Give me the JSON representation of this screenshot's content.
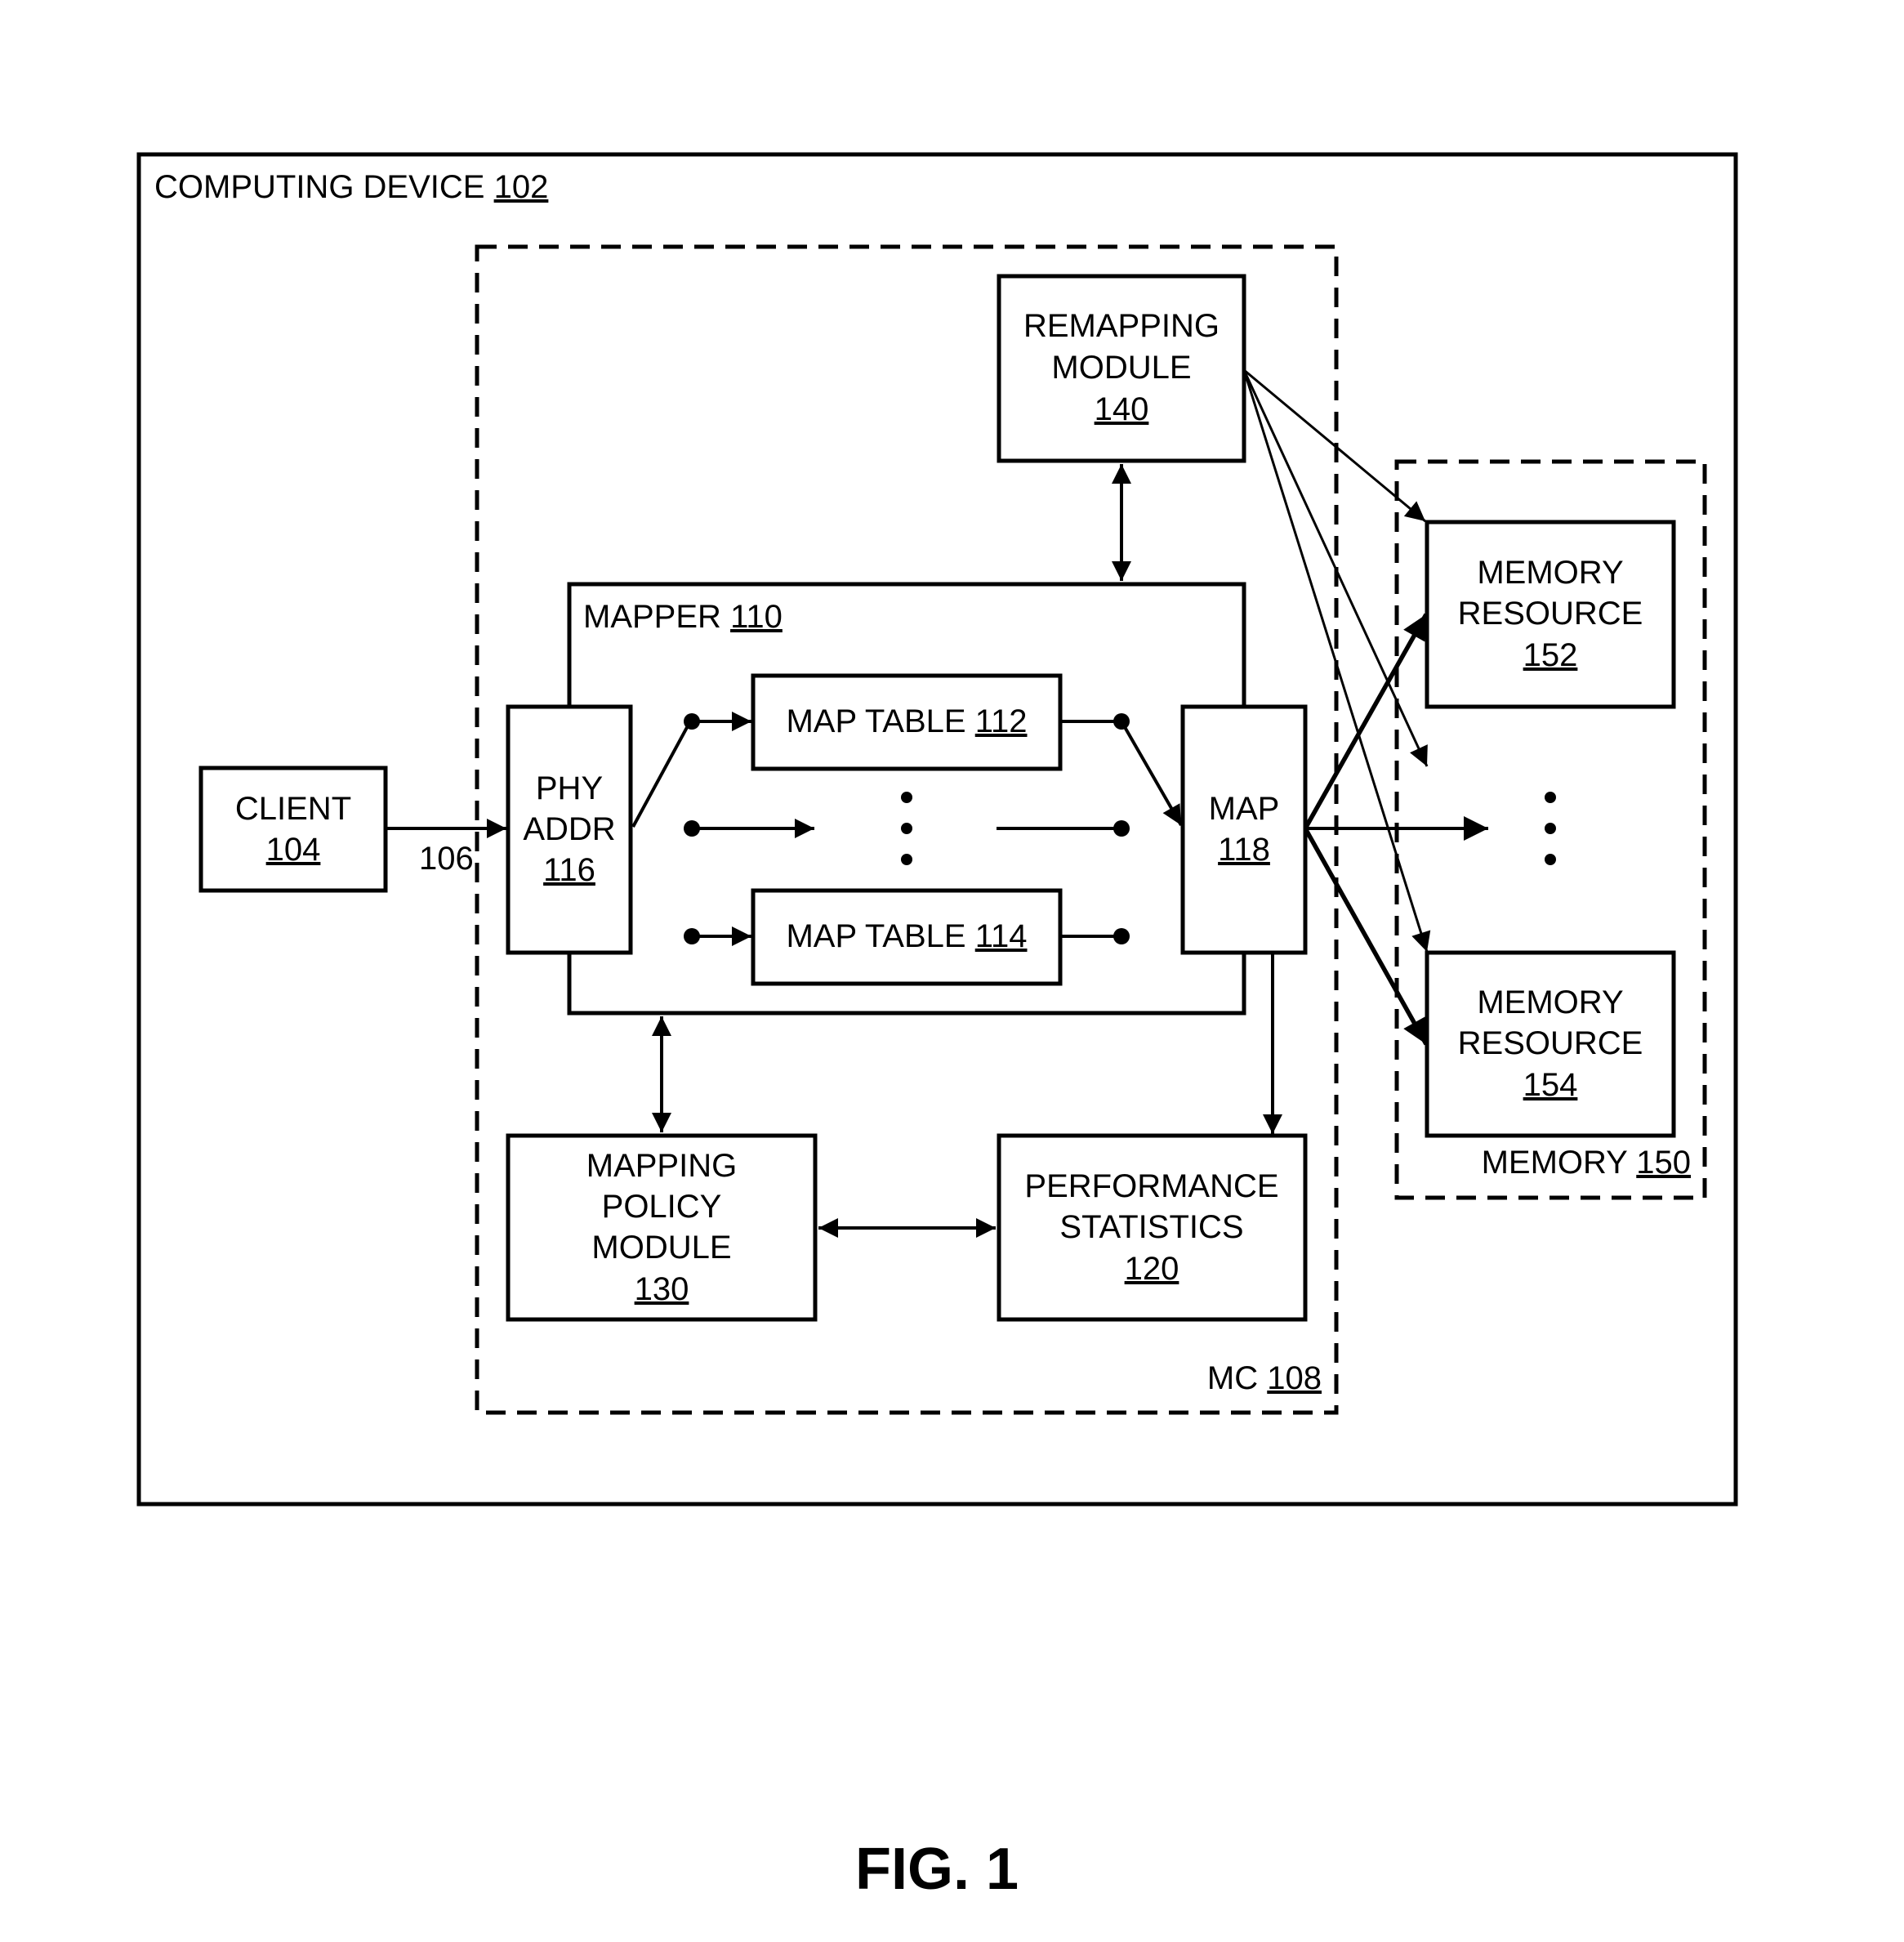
{
  "figure_label": "FIG. 1",
  "computing_device": {
    "label": "COMPUTING DEVICE",
    "ref": "102"
  },
  "mc": {
    "label": "MC",
    "ref": "108"
  },
  "client": {
    "label": "CLIENT",
    "ref": "104"
  },
  "link_106": "106",
  "remapping_module": {
    "line1": "REMAPPING",
    "line2": "MODULE",
    "ref": "140"
  },
  "mapper": {
    "label": "MAPPER",
    "ref": "110"
  },
  "phy_addr": {
    "line1": "PHY",
    "line2": "ADDR",
    "ref": "116"
  },
  "map_table_112": {
    "label": "MAP TABLE",
    "ref": "112"
  },
  "map_table_114": {
    "label": "MAP TABLE",
    "ref": "114"
  },
  "map_118": {
    "label": "MAP",
    "ref": "118"
  },
  "mapping_policy_module": {
    "line1": "MAPPING",
    "line2": "POLICY",
    "line3": "MODULE",
    "ref": "130"
  },
  "performance_statistics": {
    "line1": "PERFORMANCE",
    "line2": "STATISTICS",
    "ref": "120"
  },
  "memory": {
    "label": "MEMORY",
    "ref": "150"
  },
  "memory_resource_152": {
    "line1": "MEMORY",
    "line2": "RESOURCE",
    "ref": "152"
  },
  "memory_resource_154": {
    "line1": "MEMORY",
    "line2": "RESOURCE",
    "ref": "154"
  }
}
